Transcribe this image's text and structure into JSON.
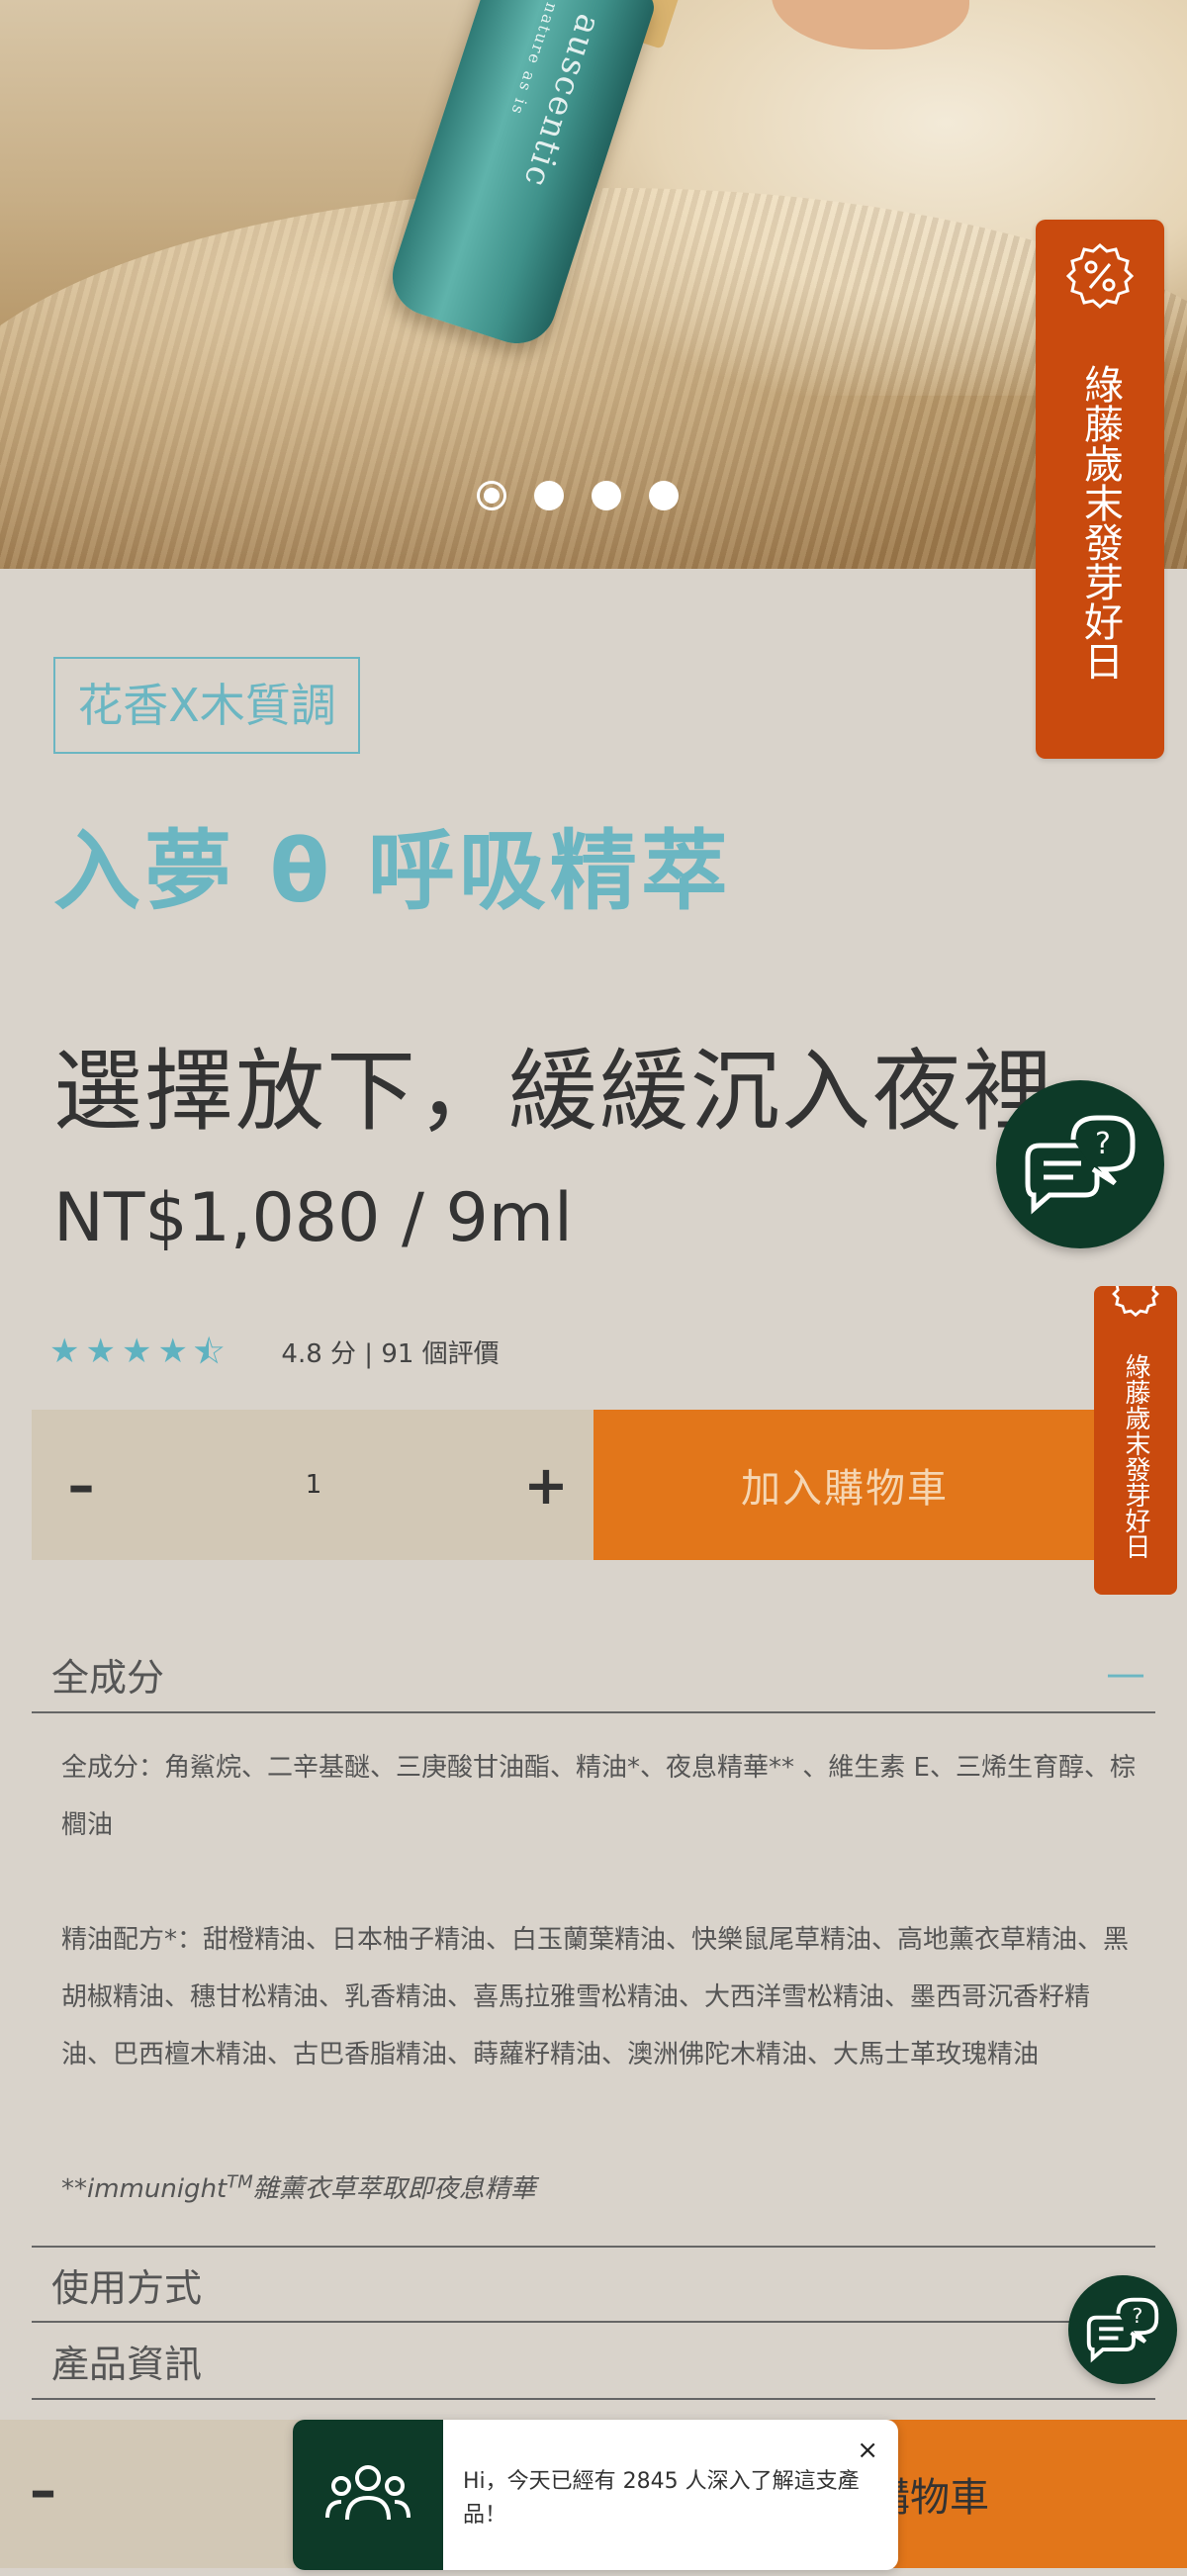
{
  "hero": {
    "bottle_brand": "auscentic",
    "bottle_tagline": "nature as is",
    "carousel_dots": 4,
    "active_dot": 0
  },
  "promo_tab": {
    "label": "綠藤歲末發芽好日",
    "color": "#c94a0e"
  },
  "product": {
    "tag": "花香X木質調",
    "title": "入夢 θ 呼吸精萃",
    "subtitle": "選擇放下，緩緩沉入夜裡",
    "price": "NT$1,080 / 9ml",
    "rating_value": 4.5,
    "rating_text": "4.8 分 | 91 個評價",
    "star_color": "#5fb2c0"
  },
  "purchase": {
    "quantity": "1",
    "minus_label": "–",
    "plus_label": "+",
    "add_to_cart": "加入購物車",
    "cart_color": "#e2761a"
  },
  "accordion": {
    "ingredients_title": "全成分",
    "ingredients_toggle": "—",
    "ingredients_text": "全成分：角鯊烷、二辛基醚、三庚酸甘油酯、精油*、夜息精華** 、維生素 E、三烯生育醇、棕櫚油",
    "essential_oils_text": "精油配方*：甜橙精油、日本柚子精油、白玉蘭葉精油、快樂鼠尾草精油、高地薰衣草精油、黑胡椒精油、穗甘松精油、乳香精油、喜馬拉雅雪松精油、大西洋雪松精油、墨西哥沉香籽精油、巴西檀木精油、古巴香脂精油、蒔蘿籽精油、澳洲佛陀木精油、大馬士革玫瑰精油",
    "footnote_prefix": "**immunight",
    "footnote_tm": "TM",
    "footnote_text": "雜薰衣草萃取即夜息精華",
    "usage_title": "使用方式",
    "info_title": "產品資訊"
  },
  "sticky_bar": {
    "minus_label": "–",
    "cart_label": "購物車"
  },
  "toast": {
    "message": "Hi，今天已經有 2845 人深入了解這支產品！",
    "close_label": "×"
  }
}
